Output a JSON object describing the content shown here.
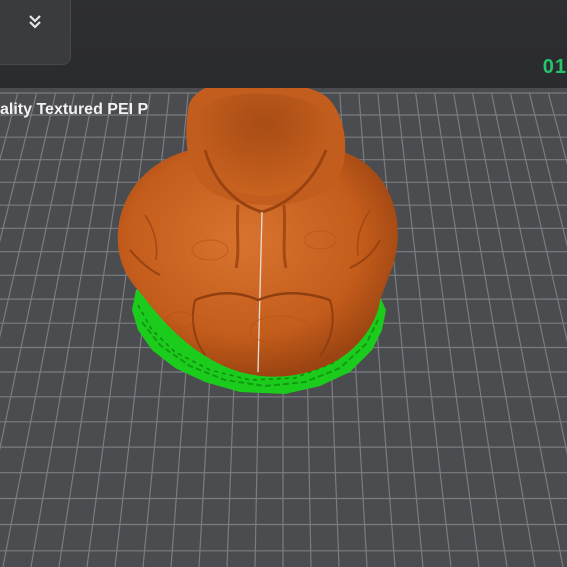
{
  "toolbar": {
    "collapse_icon": "chevrons-down-icon"
  },
  "viewport": {
    "plate_label": "ality Textured PEI P",
    "layer_indicator": "01",
    "model": "hoodie-model",
    "colors": {
      "bed": "#4b4c50",
      "grid": "#7a7b7f",
      "model": "#c9621f",
      "support": "#1fd11f",
      "layer_indicator": "#27c36a"
    }
  }
}
